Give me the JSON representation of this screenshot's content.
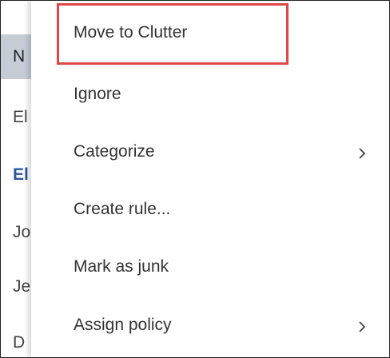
{
  "mail_list": {
    "rows": [
      "N",
      "El",
      "El",
      "Jo",
      "Je",
      "D"
    ]
  },
  "menu": {
    "items": [
      {
        "label": "Move to Clutter",
        "submenu": false
      },
      {
        "label": "Ignore",
        "submenu": false
      },
      {
        "label": "Categorize",
        "submenu": true
      },
      {
        "label": "Create rule...",
        "submenu": false
      },
      {
        "label": "Mark as junk",
        "submenu": false
      },
      {
        "label": "Assign policy",
        "submenu": true
      }
    ]
  },
  "colors": {
    "highlight": "#e04848",
    "selected_row": "#c5ccd6",
    "unread_row": "#2b579a"
  },
  "icons": {
    "submenu_arrow": "chevron-right-icon"
  }
}
